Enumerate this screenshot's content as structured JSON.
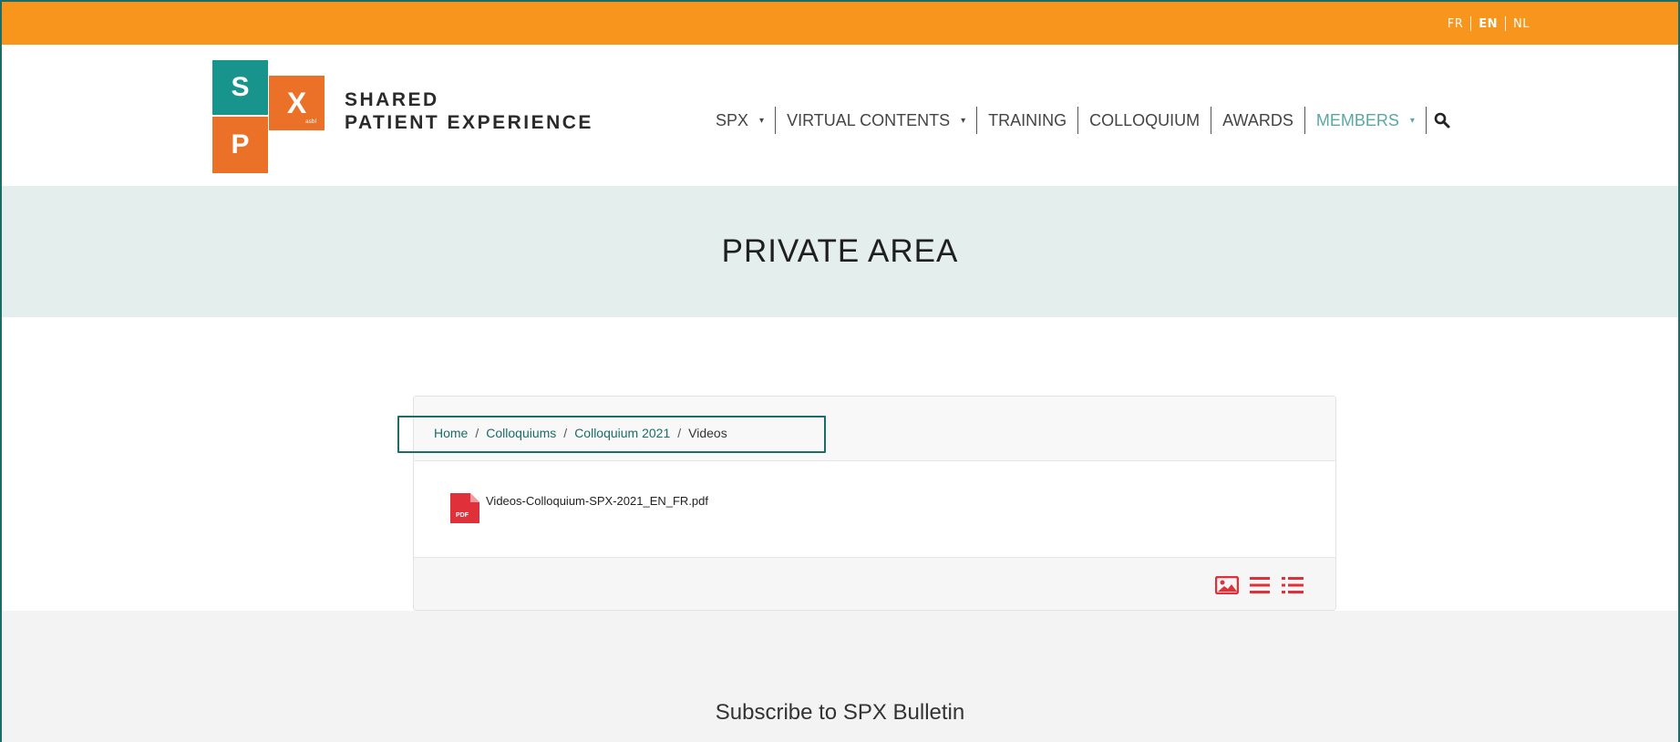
{
  "languages": [
    {
      "code": "FR",
      "active": false
    },
    {
      "code": "EN",
      "active": true
    },
    {
      "code": "NL",
      "active": false
    }
  ],
  "logo": {
    "tiles": [
      "S",
      "X",
      "P"
    ],
    "asbl": "asbl",
    "brand_line1": "SHARED",
    "brand_line2": "PATIENT EXPERIENCE"
  },
  "nav": {
    "items": [
      {
        "label": "SPX",
        "dropdown": true
      },
      {
        "label": "VIRTUAL CONTENTS",
        "dropdown": true
      },
      {
        "label": "TRAINING",
        "dropdown": false
      },
      {
        "label": "COLLOQUIUM",
        "dropdown": false
      },
      {
        "label": "AWARDS",
        "dropdown": false
      },
      {
        "label": "MEMBERS",
        "dropdown": true
      }
    ],
    "caret": "▾",
    "search_icon": "search-icon"
  },
  "banner": {
    "title": "PRIVATE AREA"
  },
  "breadcrumb": {
    "items": [
      "Home",
      "Colloquiums",
      "Colloquium 2021"
    ],
    "current": "Videos",
    "separator": "/"
  },
  "files": [
    {
      "name": "Videos-Colloquium-SPX-2021_EN_FR.pdf",
      "type": "PDF",
      "icon": "pdf-icon"
    }
  ],
  "view_options": [
    "image-view-icon",
    "list-view-icon",
    "detail-list-view-icon"
  ],
  "footer": {
    "subscribe": "Subscribe to SPX Bulletin"
  },
  "colors": {
    "orange": "#f7951d",
    "teal": "#17958d",
    "accent_red": "#e0313b",
    "highlight": "#1d6c67"
  }
}
